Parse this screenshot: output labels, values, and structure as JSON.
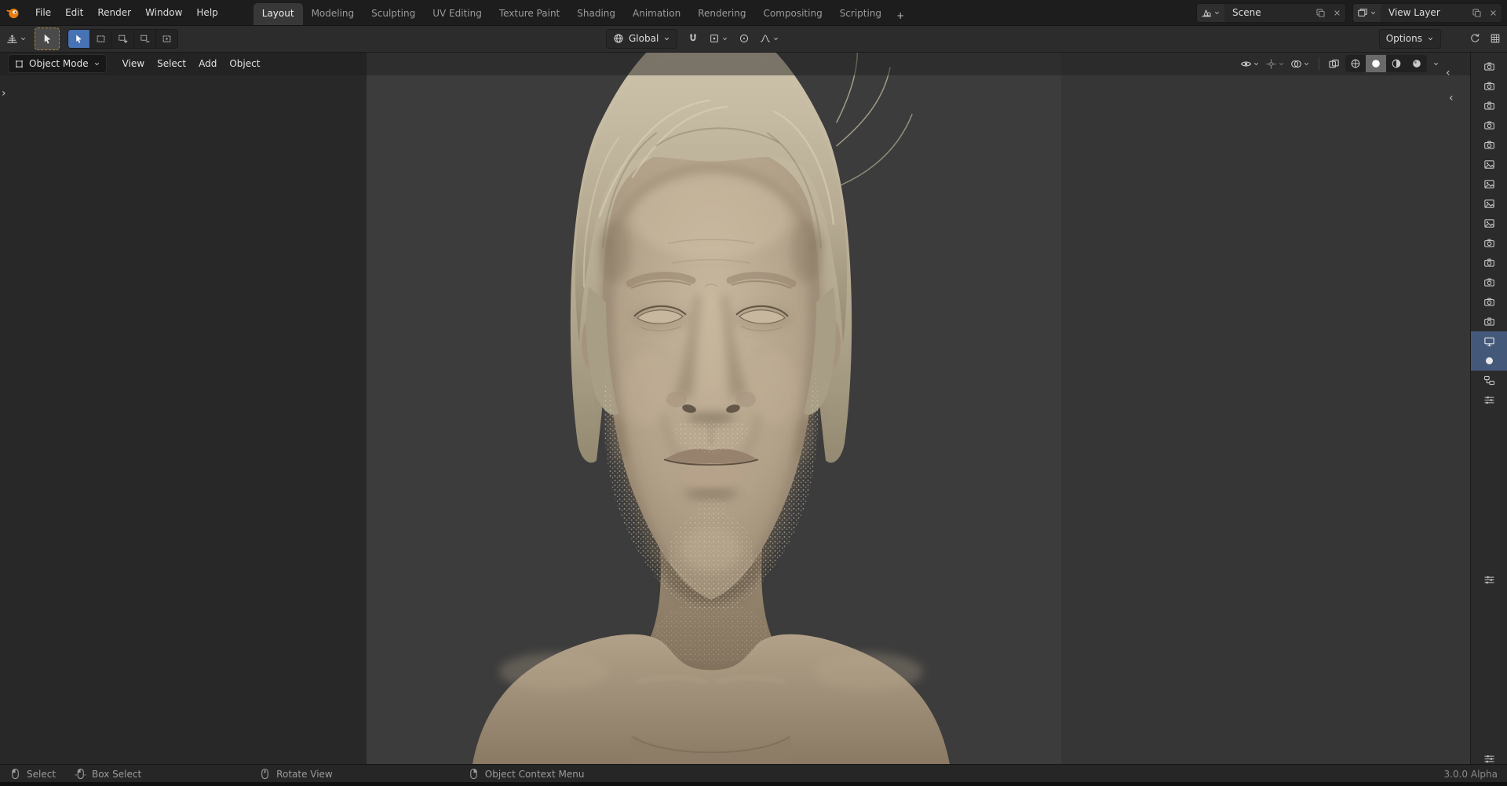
{
  "topbar": {
    "menus": [
      "File",
      "Edit",
      "Render",
      "Window",
      "Help"
    ],
    "tabs": [
      {
        "label": "Layout",
        "active": true
      },
      {
        "label": "Modeling"
      },
      {
        "label": "Sculpting"
      },
      {
        "label": "UV Editing"
      },
      {
        "label": "Texture Paint"
      },
      {
        "label": "Shading"
      },
      {
        "label": "Animation"
      },
      {
        "label": "Rendering"
      },
      {
        "label": "Compositing"
      },
      {
        "label": "Scripting"
      }
    ],
    "add_tab": "+",
    "scene_name": "Scene",
    "view_layer_name": "View Layer"
  },
  "toolbar": {
    "orientation": "Global",
    "options": "Options"
  },
  "viewport": {
    "mode": "Object Mode",
    "menus": [
      "View",
      "Select",
      "Add",
      "Object"
    ]
  },
  "statusbar": {
    "hints": [
      {
        "icon": "mouse-l",
        "label": "Select"
      },
      {
        "icon": "mouse-drag",
        "label": "Box Select"
      },
      {
        "icon": "mouse-m",
        "label": "Rotate View"
      },
      {
        "icon": "mouse-r",
        "label": "Object Context Menu"
      }
    ],
    "version": "3.0.0 Alpha"
  },
  "outliner": {
    "rows": [
      {
        "icon": "camera"
      },
      {
        "icon": "camera"
      },
      {
        "icon": "camera"
      },
      {
        "icon": "camera"
      },
      {
        "icon": "camera"
      },
      {
        "icon": "image"
      },
      {
        "icon": "image"
      },
      {
        "icon": "image"
      },
      {
        "icon": "image"
      },
      {
        "icon": "camera"
      },
      {
        "icon": "camera"
      },
      {
        "icon": "camera"
      },
      {
        "icon": "camera"
      },
      {
        "icon": "camera"
      },
      {
        "icon": "screen",
        "selected": true
      },
      {
        "icon": "sphere",
        "selected": true
      },
      {
        "icon": "nodes"
      },
      {
        "icon": "sliders"
      },
      {
        "icon": "spacer"
      },
      {
        "icon": "sliders"
      },
      {
        "icon": "spacer"
      },
      {
        "icon": "sliders"
      }
    ]
  },
  "colors": {
    "topbar_bg": "#1d1d1d",
    "toolbar_bg": "#2c2c2c",
    "canvas_left": "#282828",
    "canvas_mid": "#3c3c3c",
    "canvas_right": "#363636",
    "strip_bg": "#2b2b2b",
    "status_bg": "#262626",
    "widget_bg": "#282828",
    "accent": "#4772b3",
    "selection": "#44597a",
    "skin": "#b2a189",
    "hair": "#c8bda6",
    "blender_orange": "#e87d0d"
  }
}
